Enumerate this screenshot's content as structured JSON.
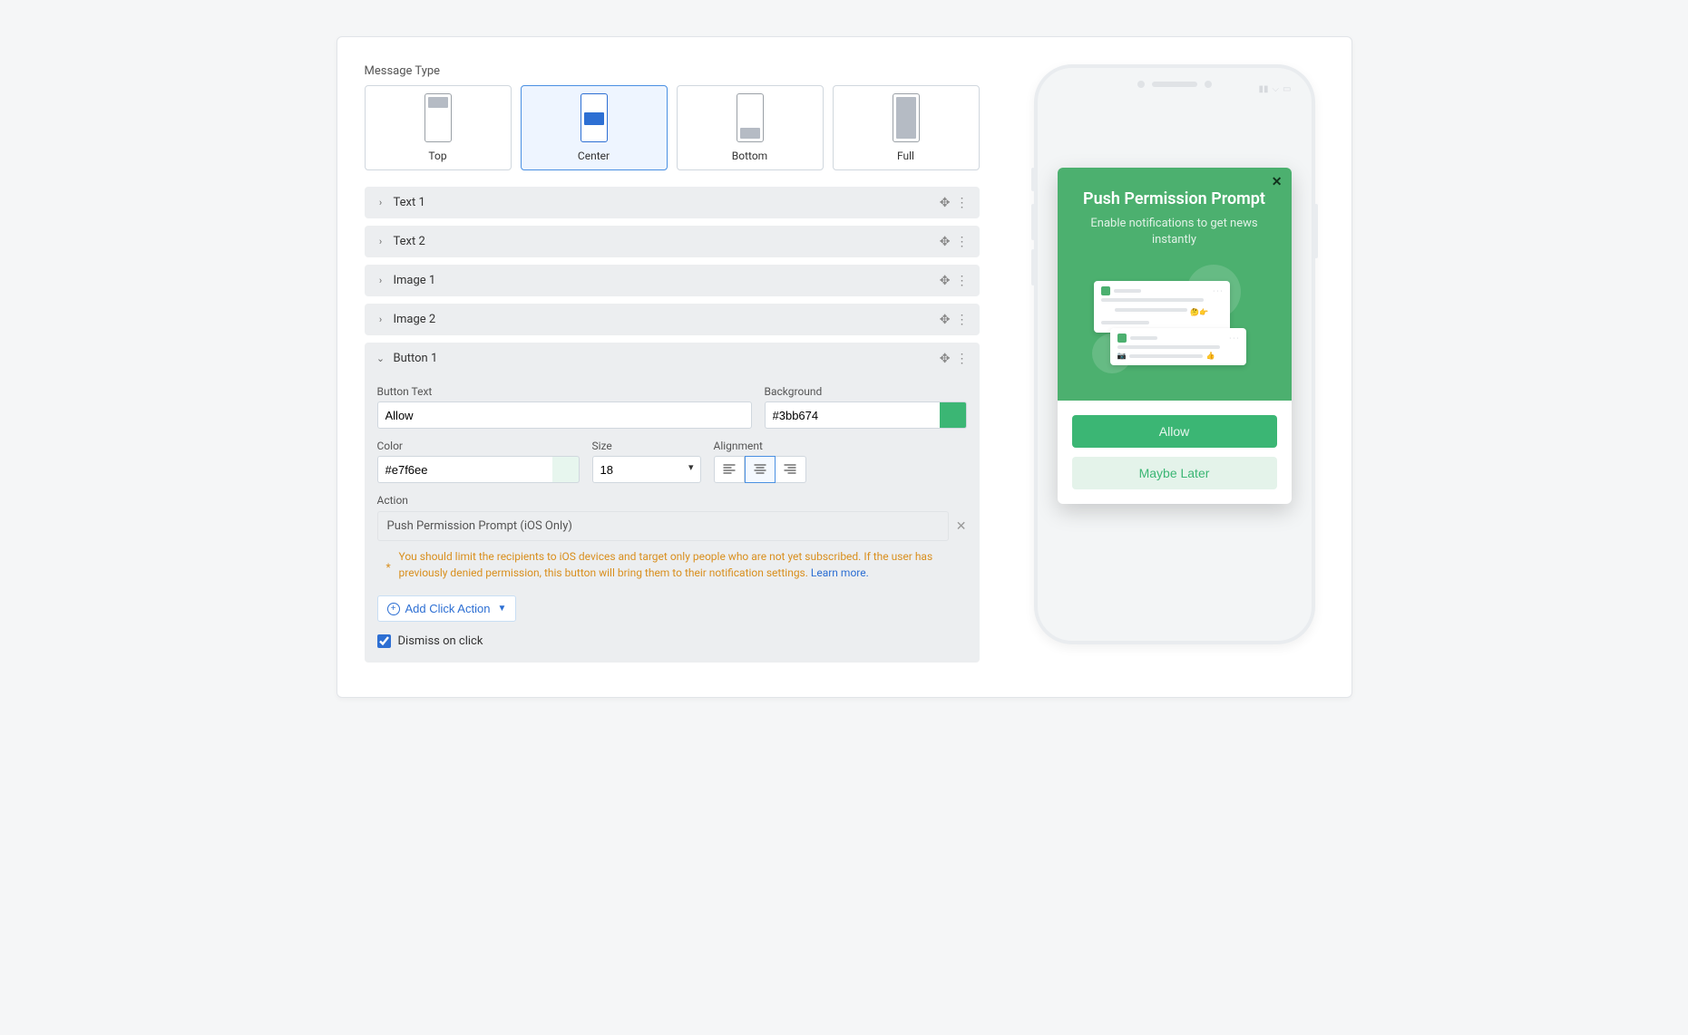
{
  "messageType": {
    "label": "Message Type",
    "options": [
      "Top",
      "Center",
      "Bottom",
      "Full"
    ],
    "selected": "Center"
  },
  "accordions": {
    "text1": "Text 1",
    "text2": "Text 2",
    "image1": "Image 1",
    "image2": "Image 2",
    "button1": "Button 1"
  },
  "button1": {
    "buttonTextLabel": "Button Text",
    "buttonText": "Allow",
    "backgroundLabel": "Background",
    "background": "#3bb674",
    "colorLabel": "Color",
    "color": "#e7f6ee",
    "sizeLabel": "Size",
    "size": "18",
    "alignmentLabel": "Alignment",
    "alignment": "center",
    "actionLabel": "Action",
    "actionValue": "Push Permission Prompt (iOS Only)",
    "actionWarning": "You should limit the recipients to iOS devices and target only people who are not yet subscribed. If the user has previously denied permission, this button will bring them to their notification settings. ",
    "learnMore": "Learn more.",
    "addClickAction": "Add Click Action",
    "dismissLabel": "Dismiss on click",
    "dismissChecked": true
  },
  "preview": {
    "title": "Push Permission Prompt",
    "subtitle": "Enable notifications to get news instantly",
    "allow": "Allow",
    "later": "Maybe Later"
  }
}
